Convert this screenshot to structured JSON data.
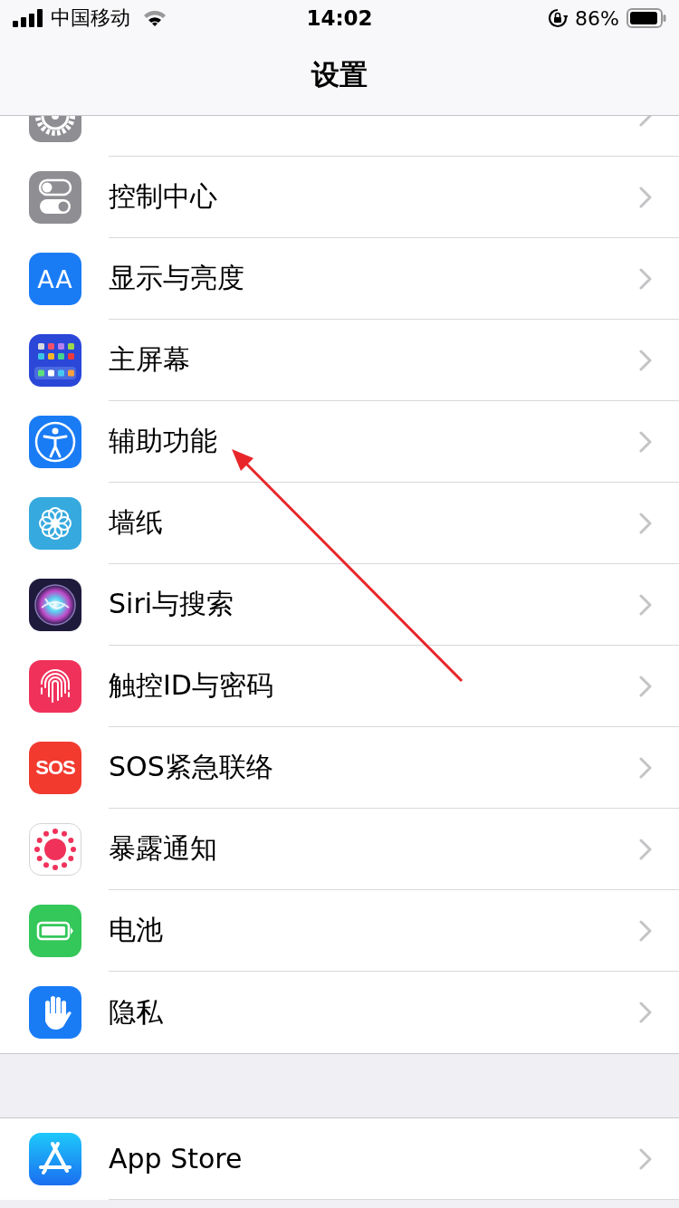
{
  "status_bar": {
    "carrier": "中国移动",
    "time": "14:02",
    "battery": "86%"
  },
  "nav_bar": {
    "title": "设置"
  },
  "groups": [
    {
      "rows": [
        {
          "kind": "general"
        },
        {
          "kind": "controls",
          "label": "控制中心"
        },
        {
          "kind": "display",
          "label": "显示与亮度",
          "icon_text": "AA"
        },
        {
          "kind": "homescreen",
          "label": "主屏幕"
        },
        {
          "kind": "accessibility",
          "label": "辅助功能"
        },
        {
          "kind": "wallpaper",
          "label": "墙纸"
        },
        {
          "kind": "siri",
          "label": "Siri与搜索"
        },
        {
          "kind": "touchid",
          "label": "触控ID与密码"
        },
        {
          "kind": "sos",
          "label": "SOS紧急联络",
          "icon_text": "SOS"
        },
        {
          "kind": "exposure",
          "label": "暴露通知"
        },
        {
          "kind": "battery",
          "label": "电池"
        },
        {
          "kind": "privacy",
          "label": "隐私"
        }
      ]
    },
    {
      "rows": [
        {
          "kind": "appstore",
          "label": "App Store"
        }
      ]
    }
  ]
}
